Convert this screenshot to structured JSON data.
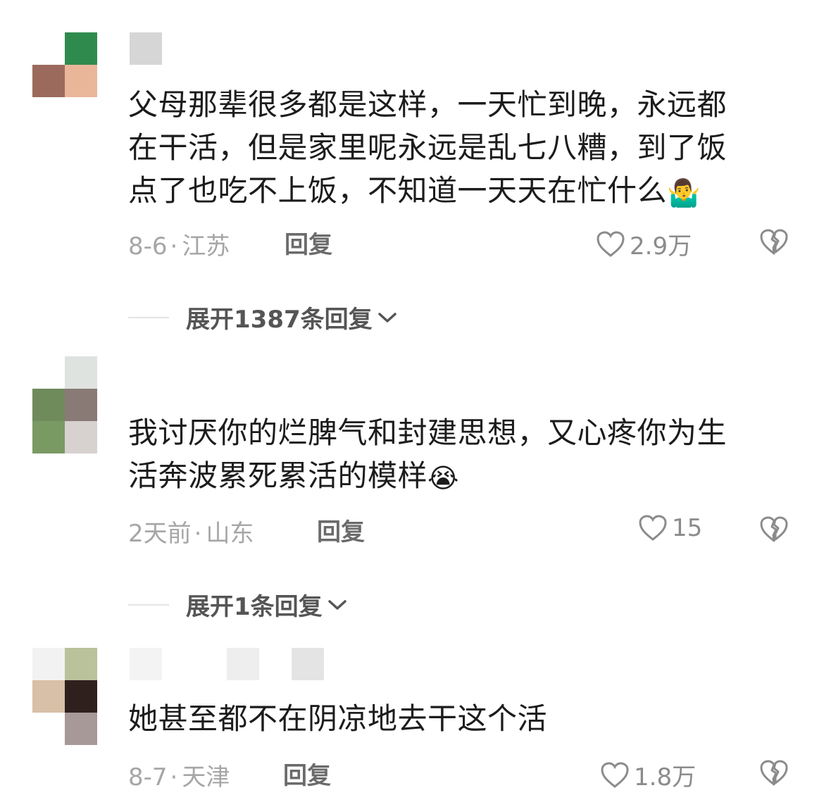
{
  "comments": [
    {
      "text_lines": [
        "父母那辈很多都是这样，一天忙到晚，永远都",
        "在干活，但是家里呢永远是乱七八糟，到了饭",
        "点了也吃不上饭，不知道一天天在忙什么"
      ],
      "emoji": "🤷‍♂️",
      "date": "8-6",
      "location": "江苏",
      "reply_label": "回复",
      "likes": "2.9万",
      "expand_label": "展开1387条回复",
      "avatar_colors": [
        "#ffffff",
        "#2f8b4d",
        "#9c6a5d",
        "#e9b69a"
      ]
    },
    {
      "text_lines": [
        "我讨厌你的烂脾气和封建思想，又心疼你为生",
        "活奔波累死累活的模样"
      ],
      "emoji": "😭",
      "date": "2天前",
      "location": "山东",
      "reply_label": "回复",
      "likes": "15",
      "expand_label": "展开1条回复",
      "avatar_colors": [
        "#ffffff",
        "#dfe3e0",
        "#6f8a5b",
        "#8a7a76",
        "#7a9a64",
        "#d7d2cf"
      ]
    },
    {
      "text_lines": [
        "她甚至都不在阴凉地去干这个活"
      ],
      "emoji": "",
      "date": "8-7",
      "location": "天津",
      "reply_label": "回复",
      "likes": "1.8万",
      "avatar_colors": [
        "#f2f2f2",
        "#b9c29a",
        "#d8bfa7",
        "#2f201d",
        "#a69997"
      ]
    }
  ],
  "separator_dot": "·",
  "icons": {
    "like": "heart-outline-icon",
    "dislike": "broken-heart-icon",
    "expand": "chevron-down-icon"
  },
  "colors": {
    "meta_text": "#a6a6a6",
    "icon_gray": "#8b8b8b"
  }
}
